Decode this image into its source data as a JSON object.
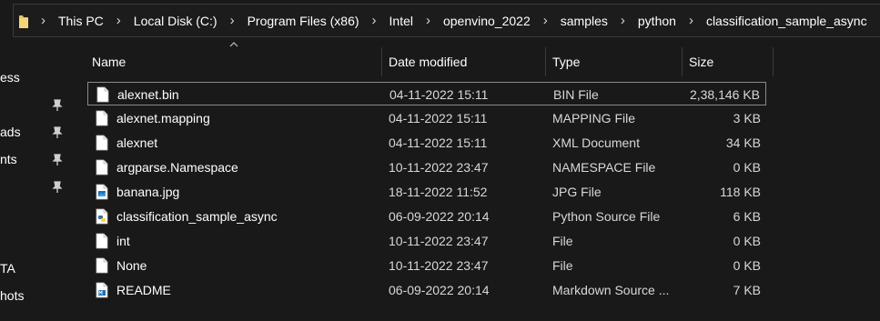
{
  "breadcrumb": [
    "This PC",
    "Local Disk (C:)",
    "Program Files (x86)",
    "Intel",
    "openvino_2022",
    "samples",
    "python",
    "classification_sample_async"
  ],
  "nav": {
    "items": [
      "ess",
      "ads",
      "nts",
      "TA",
      "hots"
    ]
  },
  "columns": {
    "name": "Name",
    "date": "Date modified",
    "type": "Type",
    "size": "Size"
  },
  "files": [
    {
      "name": "alexnet.bin",
      "date": "04-11-2022 15:11",
      "type": "BIN File",
      "size": "2,38,146 KB",
      "icon": "blank-file-icon"
    },
    {
      "name": "alexnet.mapping",
      "date": "04-11-2022 15:11",
      "type": "MAPPING File",
      "size": "3 KB",
      "icon": "blank-file-icon"
    },
    {
      "name": "alexnet",
      "date": "04-11-2022 15:11",
      "type": "XML Document",
      "size": "34 KB",
      "icon": "blank-file-icon"
    },
    {
      "name": "argparse.Namespace",
      "date": "10-11-2022 23:47",
      "type": "NAMESPACE File",
      "size": "0 KB",
      "icon": "blank-file-icon"
    },
    {
      "name": "banana.jpg",
      "date": "18-11-2022 11:52",
      "type": "JPG File",
      "size": "118 KB",
      "icon": "image-file-icon"
    },
    {
      "name": "classification_sample_async",
      "date": "06-09-2022 20:14",
      "type": "Python Source File",
      "size": "6 KB",
      "icon": "python-file-icon"
    },
    {
      "name": "int",
      "date": "10-11-2022 23:47",
      "type": "File",
      "size": "0 KB",
      "icon": "blank-file-icon"
    },
    {
      "name": "None",
      "date": "10-11-2022 23:47",
      "type": "File",
      "size": "0 KB",
      "icon": "blank-file-icon"
    },
    {
      "name": "README",
      "date": "06-09-2022 20:14",
      "type": "Markdown Source ...",
      "size": "7 KB",
      "icon": "markdown-file-icon"
    }
  ],
  "selected_index": 0,
  "colors": {
    "background": "#191919",
    "border": "#3a3a3a",
    "selection_border": "#8a8a8a",
    "folder": "#e8c25a"
  }
}
